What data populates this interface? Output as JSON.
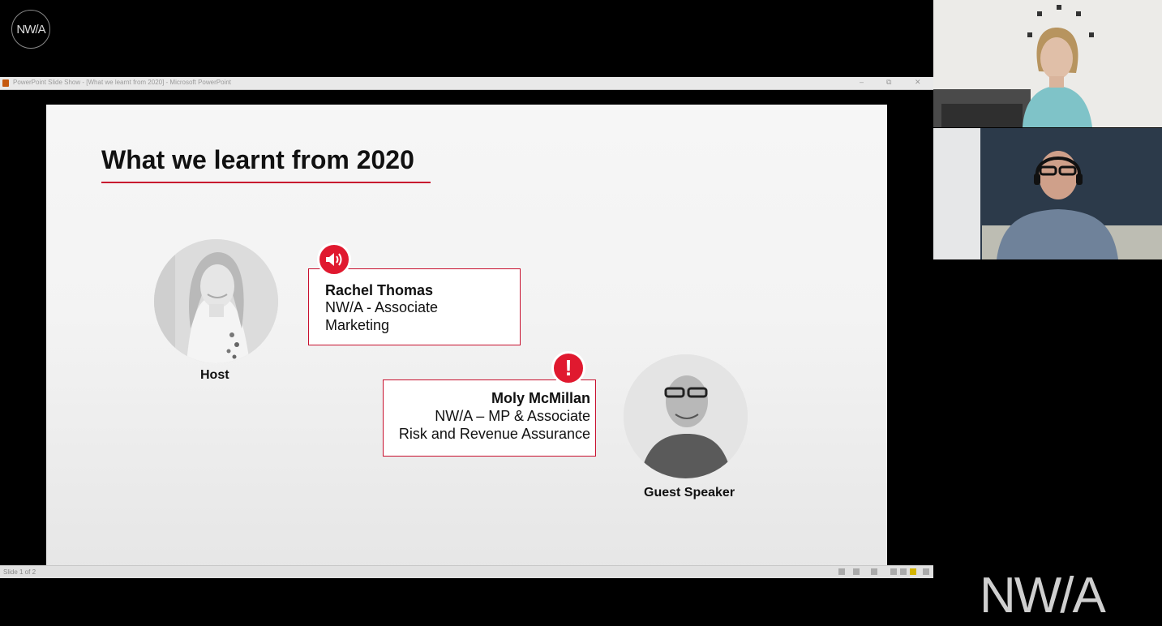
{
  "brand": {
    "logo_small": "NW/A",
    "logo_large": "NW/A",
    "accent_color": "#c8102e"
  },
  "ppt_window": {
    "title": "PowerPoint Slide Show - [What we learnt from 2020] - Microsoft PowerPoint",
    "status_slide_count": "Slide 1 of 2"
  },
  "slide": {
    "title": "What we learnt from 2020",
    "host": {
      "role_label": "Host",
      "name": "Rachel Thomas",
      "title_line1": "NW/A - Associate",
      "title_line2": "Marketing",
      "badge_icon": "speaker-icon"
    },
    "guest": {
      "role_label": "Guest Speaker",
      "name": "Moly McMillan",
      "title_line1": "NW/A – MP & Associate",
      "title_line2": "Risk and Revenue Assurance",
      "badge_icon": "exclamation-icon",
      "badge_symbol": "!"
    }
  },
  "video_feeds": [
    {
      "participant": "woman-presenter"
    },
    {
      "participant": "man-with-headset"
    }
  ]
}
